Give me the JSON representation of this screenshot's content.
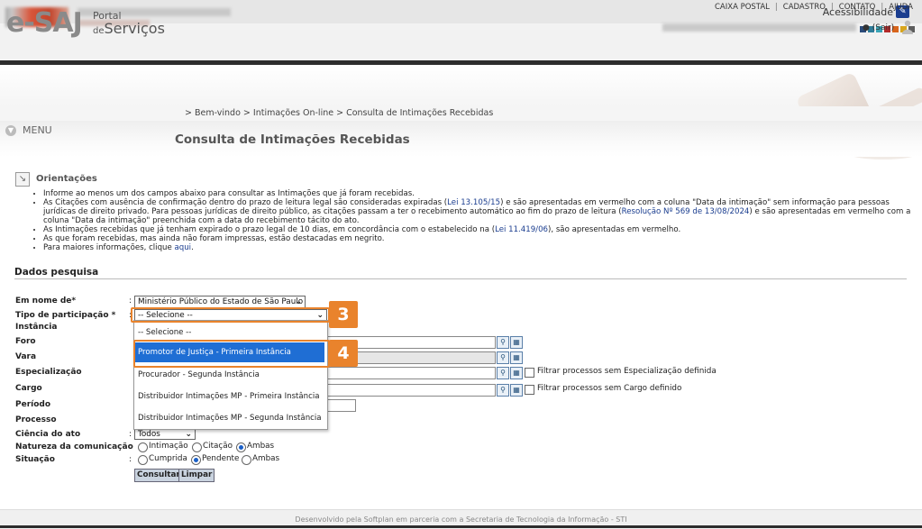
{
  "accessibility": {
    "label": "Acessibilidade"
  },
  "header": {
    "logo": "e-SAJ",
    "portal_line1": "Portal",
    "portal_line2": "de",
    "portal_line3": "Serviços",
    "links": [
      "CAIXA POSTAL",
      "CADASTRO",
      "CONTATO",
      "AJUDA"
    ],
    "sair": "(Sair)",
    "strip_colors": [
      "#2b4b7a",
      "#2f7d9a",
      "#3aa3b5",
      "#b32b2b",
      "#d8651d",
      "#d8a51d",
      "#5d5d5d"
    ]
  },
  "nav": {
    "breadcrumb": "> Bem-vindo > Intimações On-line > Consulta de Intimações Recebidas",
    "menu_label": "MENU"
  },
  "page": {
    "title": "Consulta de Intimações Recebidas"
  },
  "orientacoes": {
    "title": "Orientações",
    "items": [
      {
        "text": "Informe ao menos um dos campos abaixo para consultar as Intimações que já foram recebidas."
      },
      {
        "pre": "As Citações com ausência de confirmação dentro do prazo de leitura legal são consideradas expiradas (",
        "link1": "Lei 13.105/15",
        "mid": ") e são apresentadas em vermelho com a coluna \"Data da intimação\" sem informação para pessoas jurídicas de direito privado. Para pessoas jurídicas de direito público, as citações passam a ter o recebimento automático ao fim do prazo de leitura (",
        "link2": "Resolução Nº 569 de 13/08/2024",
        "post": ") e são apresentadas em vermelho com a coluna \"Data da intimação\" preenchida com a data do recebimento tácito do ato."
      },
      {
        "pre": "As Intimações recebidas que já tenham expirado o prazo legal de 10 dias, em concordância com o estabelecido na (",
        "link1": "Lei 11.419/06",
        "post": "), são apresentadas em vermelho."
      },
      {
        "text": "As que foram recebidas, mas ainda não foram impressas, estão destacadas em negrito."
      },
      {
        "pre": "Para maiores informações, clique ",
        "link1": "aqui",
        "post": "."
      }
    ]
  },
  "form": {
    "section_title": "Dados pesquisa",
    "labels": {
      "em_nome_de": "Em nome de*",
      "tipo_participacao": "Tipo de participação *",
      "instancia": "Instância",
      "foro": "Foro",
      "vara": "Vara",
      "especializacao": "Especialização",
      "cargo": "Cargo",
      "periodo": "Período",
      "processo": "Processo",
      "ciencia": "Ciência do ato",
      "natureza": "Natureza da comunicação",
      "situacao": "Situação"
    },
    "em_nome_de_value": "Ministério Público do Estado de São Paulo",
    "tipo_participacao_value": "-- Selecione --",
    "ciencia_value": "Todos",
    "filtro_especializacao": "Filtrar processos sem Especialização definida",
    "filtro_cargo": "Filtrar processos sem Cargo definido",
    "natureza_options": [
      "Intimação",
      "Citação",
      "Ambas"
    ],
    "natureza_selected": "Ambas",
    "situacao_options": [
      "Cumprida",
      "Pendente",
      "Ambas"
    ],
    "situacao_selected": "Pendente",
    "consultar_label": "Consultar",
    "limpar_label": "Limpar"
  },
  "dropdown": {
    "options": [
      "-- Selecione --",
      "Promotor de Justiça - Primeira Instância",
      "Procurador - Segunda Instância",
      "Distribuidor Intimações MP - Primeira Instância",
      "Distribuidor Intimações MP - Segunda Instância"
    ],
    "highlighted": "Promotor de Justiça - Primeira Instância"
  },
  "steps": {
    "step3": "3",
    "step4": "4"
  },
  "footer": {
    "text": "Desenvolvido pela Softplan em parceria com a Secretaria de Tecnologia da Informação - STI"
  }
}
